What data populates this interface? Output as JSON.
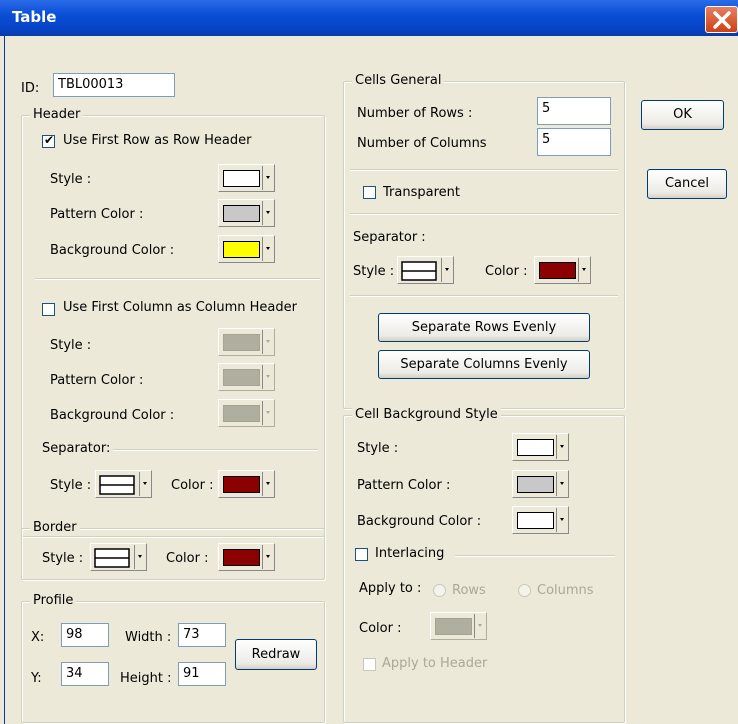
{
  "window": {
    "title": "Table"
  },
  "id": {
    "label": "ID:",
    "value": "TBL00013"
  },
  "header": {
    "legend": "Header",
    "row_header_checkbox": "Use First Row as Row Header",
    "row_style": "Style :",
    "row_pattern": "Pattern Color :",
    "row_background": "Background Color :",
    "col_header_checkbox": "Use First Column as Column Header",
    "col_style": "Style :",
    "col_pattern": "Pattern Color :",
    "col_background": "Background Color :",
    "separator": "Separator:",
    "sep_style": "Style :",
    "sep_color": "Color :"
  },
  "border": {
    "legend": "Border",
    "style": "Style :",
    "color": "Color :"
  },
  "profile": {
    "legend": "Profile",
    "x_label": "X:",
    "x_value": "98",
    "y_label": "Y:",
    "y_value": "34",
    "width_label": "Width :",
    "width_value": "73",
    "height_label": "Height :",
    "height_value": "91",
    "redraw": "Redraw"
  },
  "cells": {
    "legend": "Cells General",
    "rows_label": "Number of Rows :",
    "rows_value": "5",
    "cols_label": "Number of Columns",
    "cols_value": "5",
    "transparent": "Transparent",
    "separator": "Separator :",
    "sep_style": "Style :",
    "sep_color": "Color :",
    "sep_rows_btn": "Separate Rows Evenly",
    "sep_cols_btn": "Separate Columns Evenly"
  },
  "cell_bg": {
    "legend": "Cell Background Style",
    "style": "Style :",
    "pattern": "Pattern Color :",
    "background": "Background Color :",
    "interlacing": "Interlacing",
    "apply_to": "Apply to :",
    "rows": "Rows",
    "columns": "Columns",
    "color": "Color :",
    "apply_header": "Apply to Header"
  },
  "buttons": {
    "ok": "OK",
    "cancel": "Cancel"
  },
  "colors": {
    "white": "#ffffff",
    "pattern_gray": "#c8c8c8",
    "yellow": "#ffff00",
    "dark_red": "#8b0000",
    "disabled_gray": "#b0ae9f"
  }
}
